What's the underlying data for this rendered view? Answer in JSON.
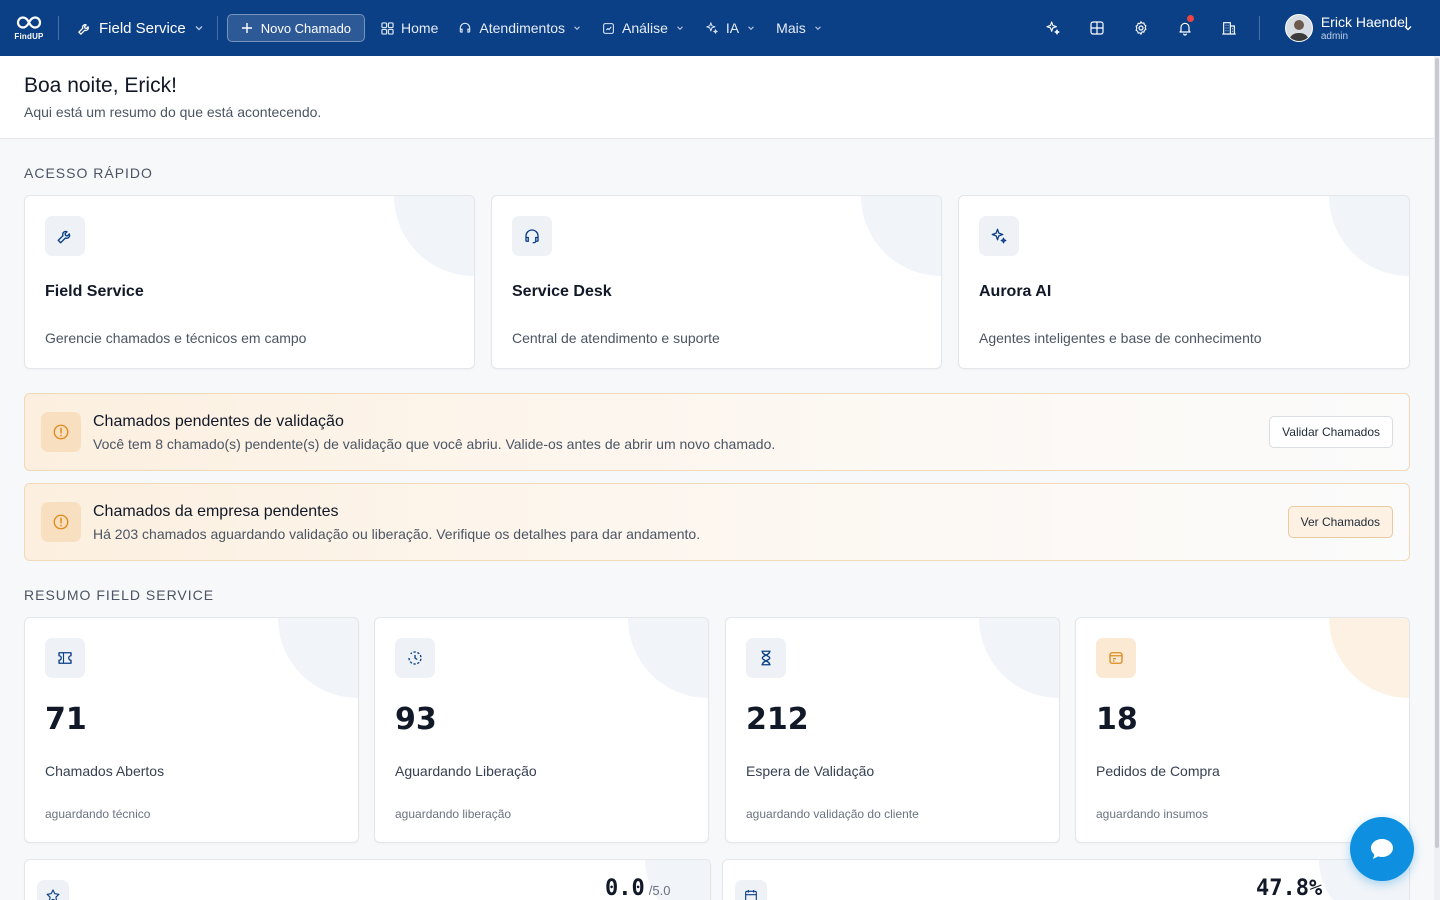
{
  "app": {
    "logo_text": "FindUP",
    "module": "Field Service"
  },
  "nav": {
    "new_ticket": "Novo Chamado",
    "home": "Home",
    "atendimentos": "Atendimentos",
    "analise": "Análise",
    "ia": "IA",
    "mais": "Mais"
  },
  "user": {
    "name": "Erick Haendel",
    "role": "admin"
  },
  "greeting": {
    "title": "Boa noite, Erick!",
    "subtitle": "Aqui está um resumo do que está acontecendo."
  },
  "quick_access": {
    "title": "ACESSO RÁPIDO",
    "cards": [
      {
        "title": "Field Service",
        "desc": "Gerencie chamados e técnicos em campo",
        "icon": "wrench-icon"
      },
      {
        "title": "Service Desk",
        "desc": "Central de atendimento e suporte",
        "icon": "headset-icon"
      },
      {
        "title": "Aurora AI",
        "desc": "Agentes inteligentes e base de conhecimento",
        "icon": "sparkles-icon"
      }
    ]
  },
  "alerts": [
    {
      "title": "Chamados pendentes de validação",
      "desc": "Você tem 8 chamado(s) pendente(s) de validação que você abriu. Valide-os antes de abrir um novo chamado.",
      "button": "Validar Chamados"
    },
    {
      "title": "Chamados da empresa pendentes",
      "desc": "Há 203 chamados aguardando validação ou liberação. Verifique os detalhes para dar andamento.",
      "button": "Ver Chamados"
    }
  ],
  "summary": {
    "title": "RESUMO FIELD SERVICE",
    "stats": [
      {
        "value": "71",
        "label": "Chamados Abertos",
        "sub": "aguardando técnico",
        "icon": "ticket-icon"
      },
      {
        "value": "93",
        "label": "Aguardando Liberação",
        "sub": "aguardando liberação",
        "icon": "clock-history-icon"
      },
      {
        "value": "212",
        "label": "Espera de Validação",
        "sub": "aguardando validação do cliente",
        "icon": "hourglass-icon"
      },
      {
        "value": "18",
        "label": "Pedidos de Compra",
        "sub": "aguardando insumos",
        "icon": "purchase-order-icon"
      }
    ]
  },
  "bottom": {
    "rating": {
      "value": "0.0",
      "max": "/5.0",
      "icon": "star-icon"
    },
    "rate": {
      "value": "47.8%",
      "icon": "calendar-icon"
    }
  },
  "colors": {
    "brand": "#0b3f86",
    "accent": "#0e8fe0",
    "warning": "#e08a1e"
  }
}
